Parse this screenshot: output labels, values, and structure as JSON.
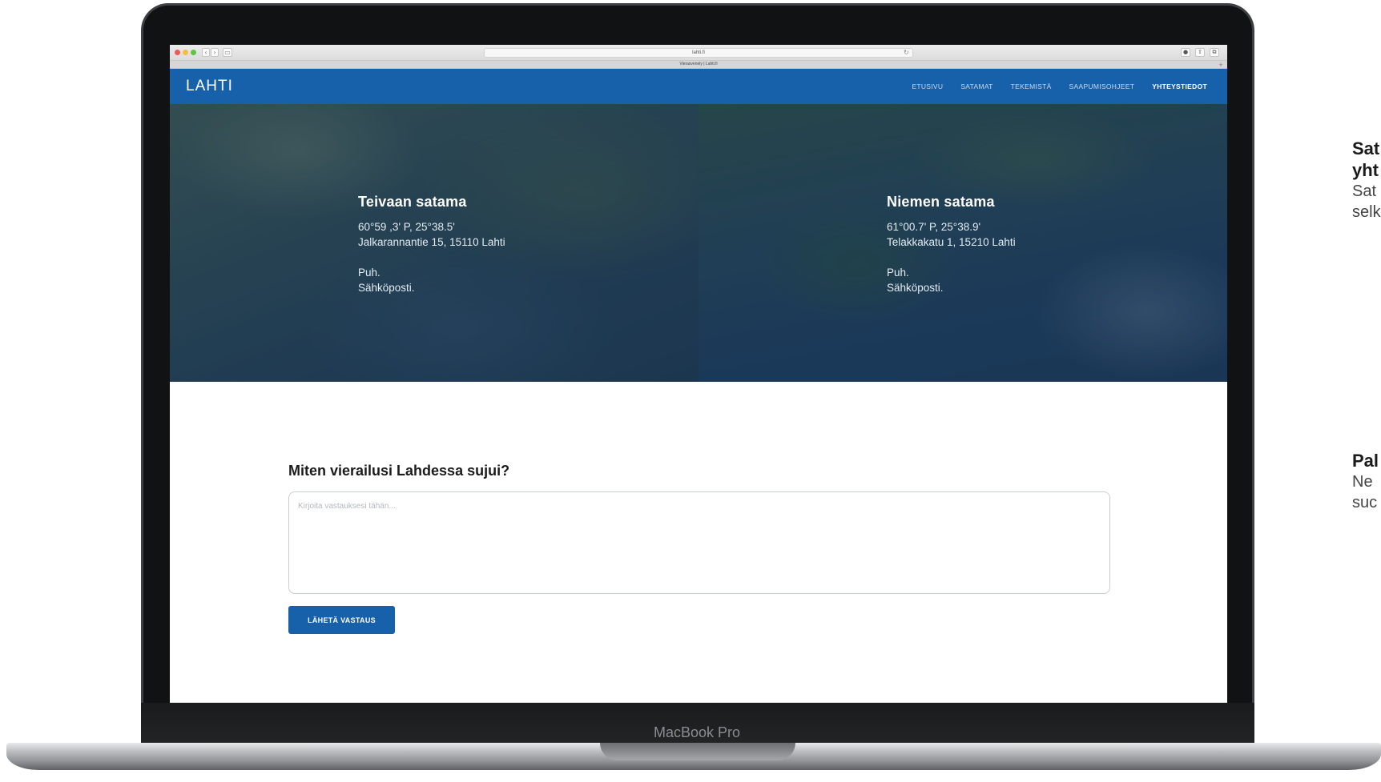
{
  "device": {
    "label": "MacBook Pro"
  },
  "browser": {
    "url": "lahti.fi",
    "tab_title": "Vierasvenely | Lahti.fi",
    "back_glyph": "‹",
    "forward_glyph": "›",
    "sidebar_glyph": "▭",
    "reload_glyph": "↻",
    "extension_glyph": "●",
    "share_glyph": "⇧",
    "tabs_glyph": "⧉",
    "new_tab_glyph": "+"
  },
  "site": {
    "logo": "LAHTI",
    "brand_color": "#1761ab",
    "nav": [
      {
        "label": "ETUSIVU",
        "active": false
      },
      {
        "label": "SATAMAT",
        "active": false
      },
      {
        "label": "TEKEMISTÄ",
        "active": false
      },
      {
        "label": "SAAPUMISOHJEET",
        "active": false
      },
      {
        "label": "YHTEYSTIEDOT",
        "active": true
      }
    ]
  },
  "harbors": [
    {
      "name": "Teivaan satama",
      "coords": "60°59 ,3' P, 25°38.5'",
      "address": "Jalkarannantie 15, 15110 Lahti",
      "phone_label": "Puh.",
      "email_label": "Sähköposti."
    },
    {
      "name": "Niemen satama",
      "coords": "61°00.7' P, 25°38.9'",
      "address": "Telakkakatu 1, 15210 Lahti",
      "phone_label": "Puh.",
      "email_label": "Sähköposti."
    }
  ],
  "feedback": {
    "title": "Miten vierailusi Lahdessa sujui?",
    "placeholder": "Kirjoita vastauksesi tähän...",
    "submit_label": "LÄHETÄ VASTAUS"
  },
  "side_notes": [
    {
      "title_line1": "Sat",
      "title_line2": "yht",
      "body_line1": "Sat",
      "body_line2": "selk"
    },
    {
      "title_line1": "Pal",
      "title_line2": "",
      "body_line1": "Ne",
      "body_line2": "suc"
    }
  ]
}
